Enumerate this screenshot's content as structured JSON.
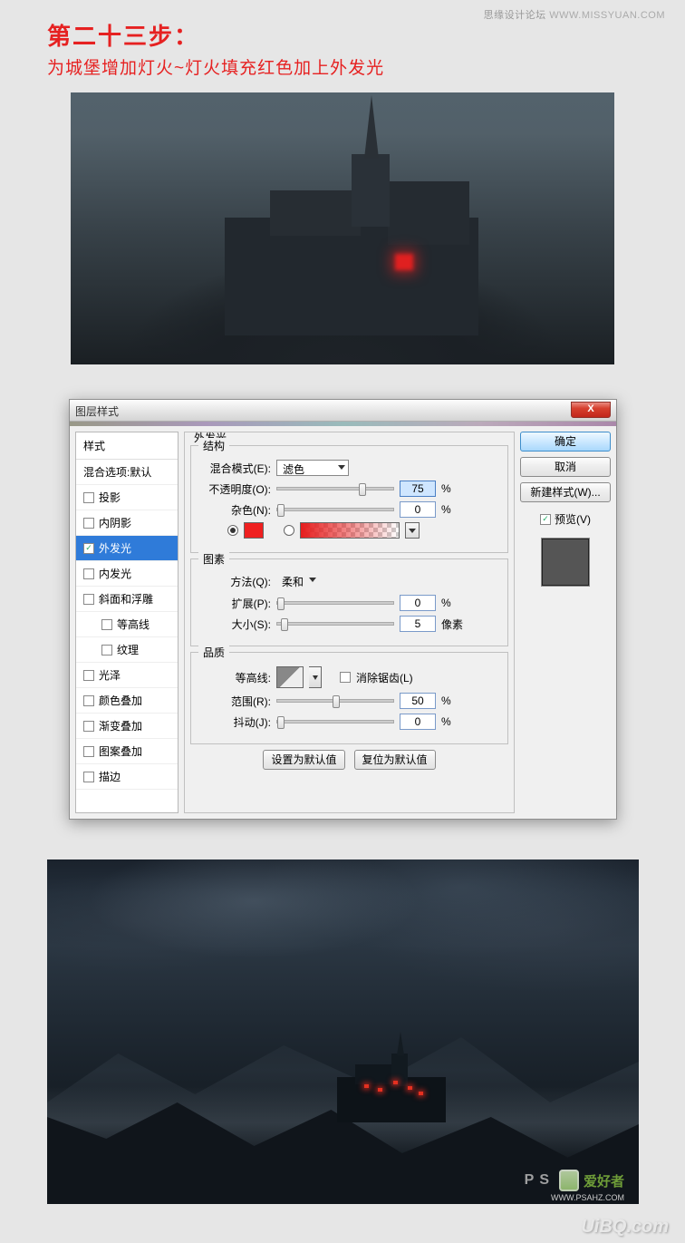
{
  "header": {
    "cn": "思缘设计论坛",
    "en": "WWW.MISSYUAN.COM"
  },
  "title": "第二十三步：",
  "subtitle": "为城堡增加灯火~灯火填充红色加上外发光",
  "dialog": {
    "title": "图层样式",
    "close": "X",
    "styles_header": "样式",
    "styles": {
      "blend_default": "混合选项:默认",
      "drop_shadow": "投影",
      "inner_shadow": "内阴影",
      "outer_glow": "外发光",
      "inner_glow": "内发光",
      "bevel": "斜面和浮雕",
      "contour": "等高线",
      "texture": "纹理",
      "satin": "光泽",
      "color_overlay": "颜色叠加",
      "gradient_overlay": "渐变叠加",
      "pattern_overlay": "图案叠加",
      "stroke": "描边"
    },
    "panel_title": "外发光",
    "structure": {
      "legend": "结构",
      "blend_mode_label": "混合模式(E):",
      "blend_mode_value": "滤色",
      "opacity_label": "不透明度(O):",
      "opacity_value": "75",
      "opacity_unit": "%",
      "noise_label": "杂色(N):",
      "noise_value": "0",
      "noise_unit": "%"
    },
    "elements": {
      "legend": "图素",
      "technique_label": "方法(Q):",
      "technique_value": "柔和",
      "spread_label": "扩展(P):",
      "spread_value": "0",
      "spread_unit": "%",
      "size_label": "大小(S):",
      "size_value": "5",
      "size_unit": "像素"
    },
    "quality": {
      "legend": "品质",
      "contour_label": "等高线:",
      "antialias_label": "消除锯齿(L)",
      "range_label": "范围(R):",
      "range_value": "50",
      "range_unit": "%",
      "jitter_label": "抖动(J):",
      "jitter_value": "0",
      "jitter_unit": "%"
    },
    "buttons": {
      "set_default": "设置为默认值",
      "reset_default": "复位为默认值",
      "ok": "确定",
      "cancel": "取消",
      "new_style": "新建样式(W)...",
      "preview": "预览(V)"
    }
  },
  "watermark": {
    "ps": "PS",
    "txt": "爱好者",
    "small": "WWW.PSAHZ.COM"
  },
  "footer": "UiBQ.com"
}
